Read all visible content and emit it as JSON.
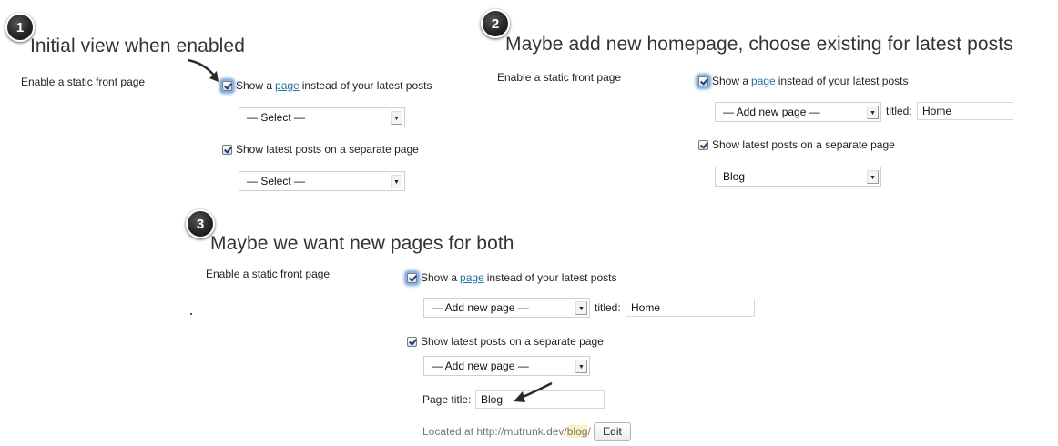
{
  "badges": [
    "1",
    "2",
    "3"
  ],
  "s1": {
    "heading": "Initial view when enabled",
    "section_label": "Enable a static front page",
    "opt_page_prefix": "Show a ",
    "opt_page_link": "page",
    "opt_page_suffix": " instead of your latest posts",
    "select1": "— Select —",
    "opt_posts": "Show latest posts on a separate page",
    "select2": "— Select —"
  },
  "s2": {
    "heading": "Maybe add new homepage, choose existing for latest posts",
    "section_label": "Enable a static front page",
    "opt_page_prefix": "Show a ",
    "opt_page_link": "page",
    "opt_page_suffix": " instead of your latest posts",
    "select1": "— Add new page —",
    "titled_label": "titled:",
    "title_value": "Home",
    "opt_posts": "Show latest posts on a separate page",
    "select2": "Blog"
  },
  "s3": {
    "heading": "Maybe we want new pages for both",
    "section_label": "Enable a static front page",
    "opt_page_prefix": "Show a ",
    "opt_page_link": "page",
    "opt_page_suffix": " instead of your latest posts",
    "select1": "— Add new page —",
    "titled_label": "titled:",
    "title_value": "Home",
    "opt_posts": "Show latest posts on a separate page",
    "select2": "— Add new page —",
    "page_title_label": "Page title:",
    "page_title_value": "Blog",
    "located_prefix": "Located at http://mutrunk.dev/",
    "located_slug": "blog",
    "located_suffix": "/",
    "edit_button": "Edit"
  },
  "colors": {
    "link": "#21759b",
    "checkbox_focus": "#6ea1dd",
    "slug_highlight": "#fbf3bd"
  },
  "icons": {
    "badge": "numbered-circle-badge",
    "pointer": "curved-arrow-icon",
    "dropdown": "dropdown-arrow-icon",
    "checkbox": "checked-checkbox-icon"
  }
}
